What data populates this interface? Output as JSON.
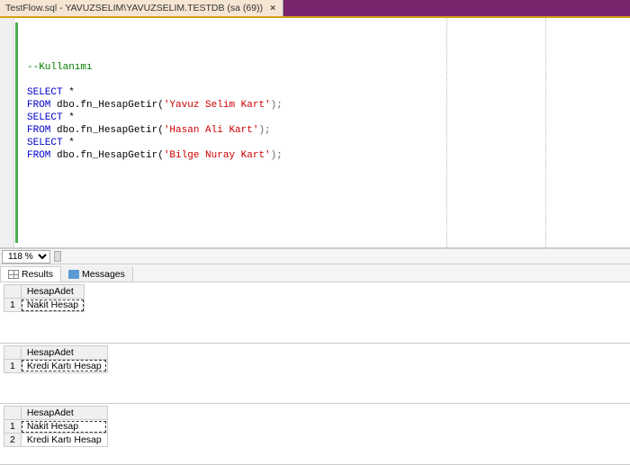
{
  "tab": {
    "title": "TestFlow.sql - YAVUZSELIM\\YAVUZSELIM.TESTDB (sa (69))",
    "close": "×"
  },
  "zoom": {
    "value": "118 %"
  },
  "code": {
    "comment": "--Kullanımı",
    "sel": "SELECT",
    "star": " *",
    "from": "FROM",
    "call": " dbo.fn_HesapGetir(",
    "p1": "'Yavuz Selim Kart'",
    "p2": "'Hasan Ali Kart'",
    "p3": "'Bilge Nuray Kart'",
    "end": ");"
  },
  "resultsTabs": {
    "results": "Results",
    "messages": "Messages"
  },
  "col": "HesapAdet",
  "r1": {
    "row1": "1",
    "v1": "Nakit Hesap"
  },
  "r2": {
    "row1": "1",
    "v1": "Kredi Kartı Hesap"
  },
  "r3": {
    "row1": "1",
    "v1": "Nakit Hesap",
    "row2": "2",
    "v2": "Kredi Kartı Hesap"
  }
}
